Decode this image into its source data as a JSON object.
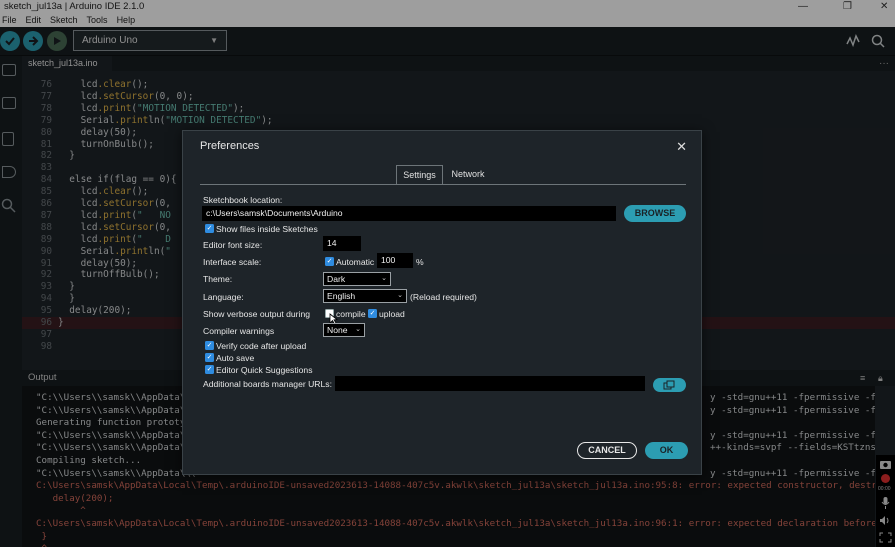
{
  "window": {
    "title": "sketch_jul13a | Arduino IDE 2.1.0",
    "controls": {
      "minimize": "—",
      "restore": "❐",
      "close": "✕"
    }
  },
  "menu": [
    "File",
    "Edit",
    "Sketch",
    "Tools",
    "Help"
  ],
  "toolbar": {
    "board": "Arduino Uno"
  },
  "tabs": {
    "active": "sketch_jul13a.ino"
  },
  "editor": {
    "lines": [
      {
        "n": "76",
        "code": "    lcd.clear();"
      },
      {
        "n": "77",
        "code": "    lcd.setCursor(0, 0);"
      },
      {
        "n": "78",
        "code": "    lcd.print(\"MOTION DETECTED\");"
      },
      {
        "n": "79",
        "code": "    Serial.println(\"MOTION DETECTED\");"
      },
      {
        "n": "80",
        "code": "    delay(50);"
      },
      {
        "n": "81",
        "code": "    turnOnBulb();"
      },
      {
        "n": "82",
        "code": "  }"
      },
      {
        "n": "83",
        "code": ""
      },
      {
        "n": "84",
        "code": "  else if(flag == 0){"
      },
      {
        "n": "85",
        "code": "    lcd.clear();"
      },
      {
        "n": "86",
        "code": "    lcd.setCursor(0,"
      },
      {
        "n": "87",
        "code": "    lcd.print(\"   NO"
      },
      {
        "n": "88",
        "code": "    lcd.setCursor(0,"
      },
      {
        "n": "89",
        "code": "    lcd.print(\"    D"
      },
      {
        "n": "90",
        "code": "    Serial.println(\""
      },
      {
        "n": "91",
        "code": "    delay(50);"
      },
      {
        "n": "92",
        "code": "    turnOffBulb();"
      },
      {
        "n": "93",
        "code": "  }"
      },
      {
        "n": "94",
        "code": "  }"
      },
      {
        "n": "95",
        "code": "  delay(200);"
      },
      {
        "n": "96",
        "code": "}"
      },
      {
        "n": "97",
        "code": ""
      },
      {
        "n": "98",
        "code": ""
      }
    ]
  },
  "output": {
    "title": "Output",
    "lines": [
      {
        "text": "\"C:\\\\Users\\\\samsk\\\\AppData\\\\(",
        "right": "y -std=gnu++11 -fpermissive -fno-excep",
        "err": false
      },
      {
        "text": "\"C:\\\\Users\\\\samsk\\\\AppData\\\\(",
        "right": "y -std=gnu++11 -fpermissive -fno-excep",
        "err": false
      },
      {
        "text": "Generating function prototype",
        "right": "",
        "err": false
      },
      {
        "text": "\"C:\\\\Users\\\\samsk\\\\AppData\\\\(",
        "right": "y -std=gnu++11 -fpermissive -fno-excep",
        "err": false
      },
      {
        "text": "\"C:\\\\Users\\\\samsk\\\\AppData\\\\(",
        "right": "++-kinds=svpf --fields=KSTtzns --line",
        "err": false
      },
      {
        "text": "Compiling sketch...",
        "right": "",
        "err": false
      },
      {
        "text": "\"C:\\\\Users\\\\samsk\\\\AppData\\\\(",
        "right": "y -std=gnu++11 -fpermissive -fno-exce",
        "err": false
      },
      {
        "text": "C:\\Users\\samsk\\AppData\\Local\\Temp\\.arduinoIDE-unsaved2023613-14088-407c5v.akwlk\\sketch_jul13a\\sketch_jul13a.ino:95:8: error: expected constructor, destructor, or type",
        "right": "",
        "err": true
      },
      {
        "text": "   delay(200);",
        "right": "",
        "err": true
      },
      {
        "text": "        ^",
        "right": "",
        "err": true
      },
      {
        "text": "C:\\Users\\samsk\\AppData\\Local\\Temp\\.arduinoIDE-unsaved2023613-14088-407c5v.akwlk\\sketch_jul13a\\sketch_jul13a.ino:96:1: error: expected declaration before '}' token",
        "right": "",
        "err": true
      },
      {
        "text": " }",
        "right": "",
        "err": true
      },
      {
        "text": " ^",
        "right": "",
        "err": true
      }
    ]
  },
  "dialog": {
    "title": "Preferences",
    "close": "✕",
    "tabs": [
      "Settings",
      "Network"
    ],
    "sketchbook_label": "Sketchbook location:",
    "sketchbook_value": "c:\\Users\\samsk\\Documents\\Arduino",
    "browse": "BROWSE",
    "show_files": "Show files inside Sketches",
    "font_size_label": "Editor font size:",
    "font_size_value": "14",
    "scale_label": "Interface scale:",
    "scale_auto": "Automatic",
    "scale_value": "100",
    "scale_unit": "%",
    "theme_label": "Theme:",
    "theme_value": "Dark",
    "language_label": "Language:",
    "language_value": "English",
    "language_note": "(Reload required)",
    "verbose_label": "Show verbose output during",
    "verbose_compile": "compile",
    "verbose_upload": "upload",
    "warnings_label": "Compiler warnings",
    "warnings_value": "None",
    "verify": "Verify code after upload",
    "autosave": "Auto save",
    "quick_suggestions": "Editor Quick Suggestions",
    "boards_label": "Additional boards manager URLs:",
    "boards_value": "",
    "cancel": "CANCEL",
    "ok": "OK"
  }
}
